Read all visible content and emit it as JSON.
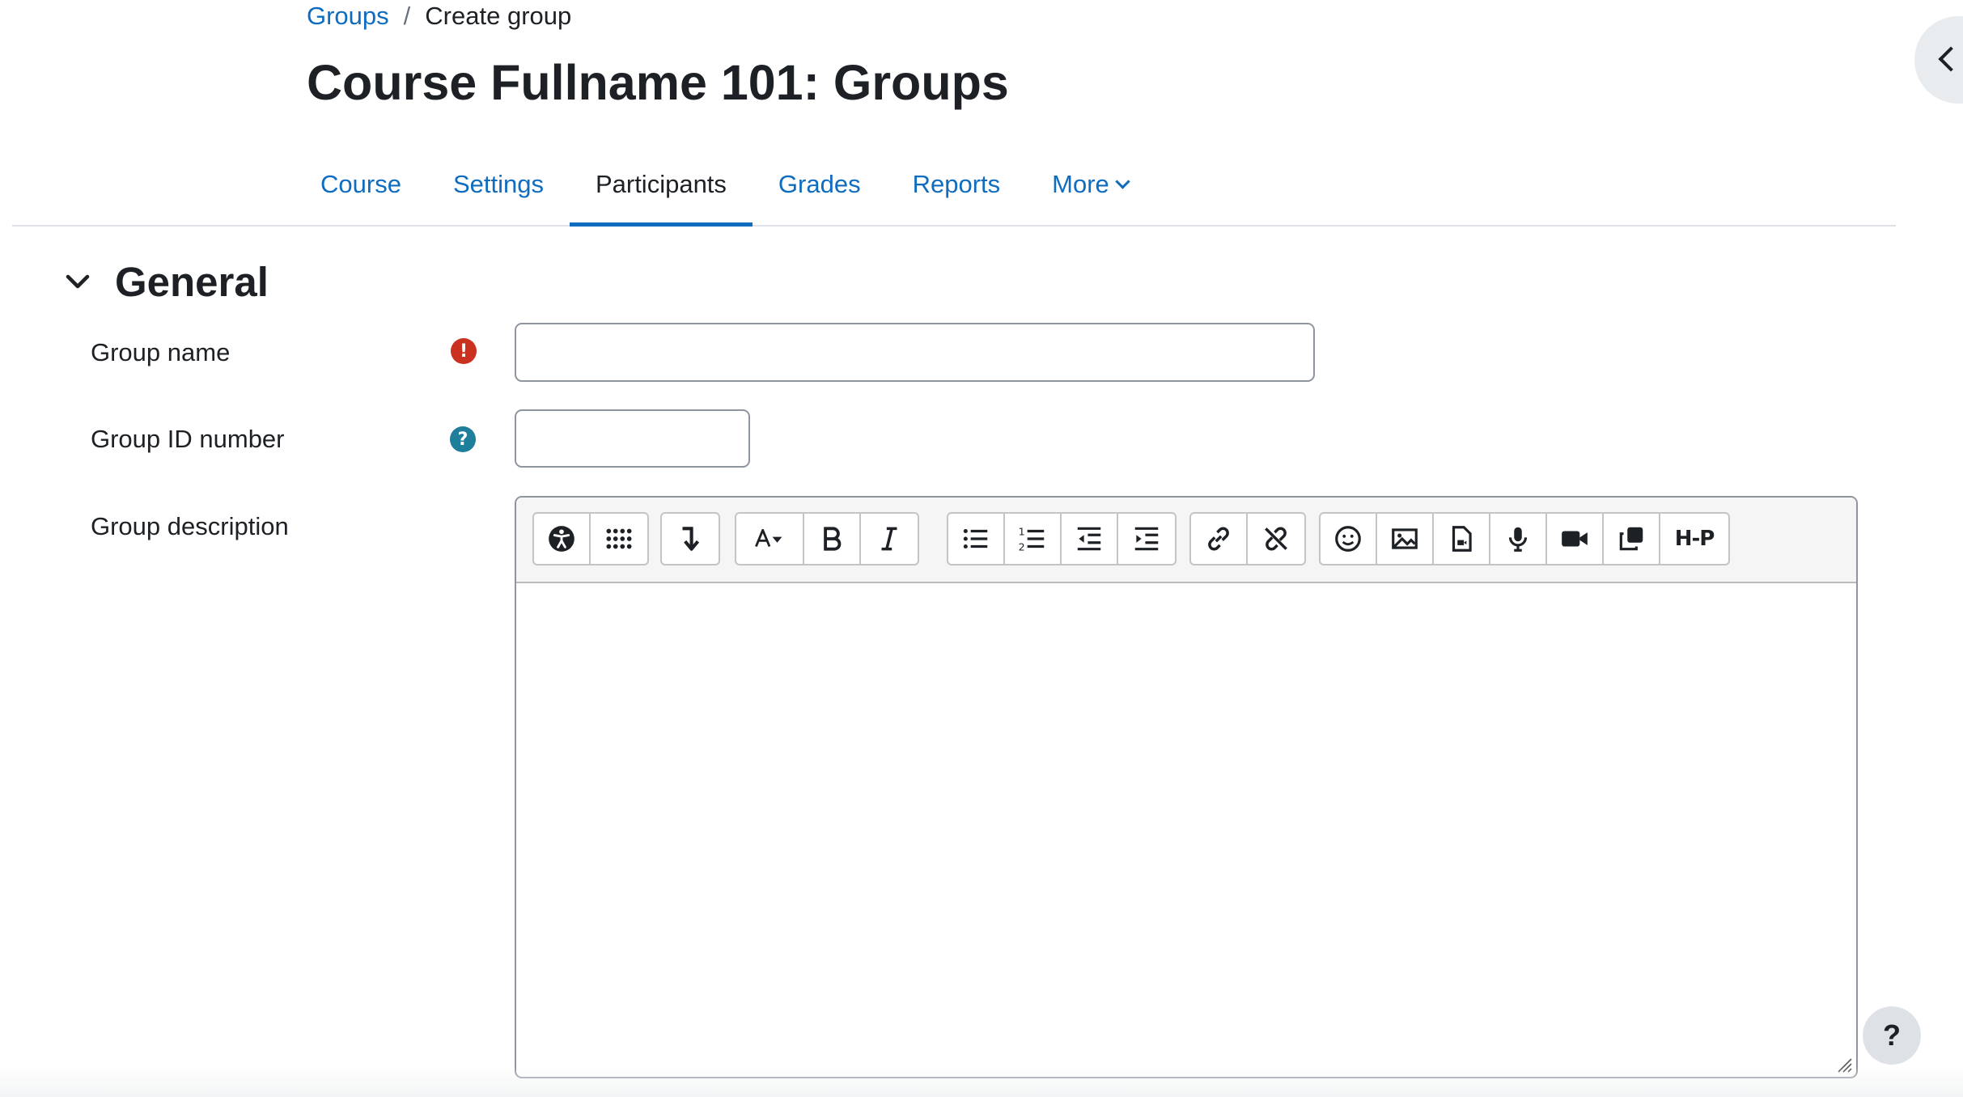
{
  "breadcrumb": {
    "parent": "Groups",
    "separator": "/",
    "current": "Create group"
  },
  "page_title": "Course Fullname 101: Groups",
  "nav": {
    "items": [
      {
        "label": "Course",
        "active": false
      },
      {
        "label": "Settings",
        "active": false
      },
      {
        "label": "Participants",
        "active": true
      },
      {
        "label": "Grades",
        "active": false
      },
      {
        "label": "Reports",
        "active": false
      },
      {
        "label": "More",
        "active": false
      }
    ]
  },
  "section": {
    "title": "General"
  },
  "form": {
    "group_name": {
      "label": "Group name",
      "value": "",
      "required_icon": "!"
    },
    "group_id": {
      "label": "Group ID number",
      "value": "",
      "help_icon": "?"
    },
    "group_description": {
      "label": "Group description"
    }
  },
  "editor": {
    "h5p_label": "H-P",
    "toolbar_icons": [
      "accessibility-checker",
      "show-more",
      "screenreader-helper",
      "font-style",
      "bold",
      "italic",
      "unordered-list",
      "ordered-list",
      "outdent",
      "indent",
      "link",
      "unlink",
      "emoji",
      "image",
      "media-file",
      "record-audio",
      "record-video",
      "manage-files",
      "h5p"
    ]
  },
  "help_button": "?",
  "colors": {
    "link": "#0f6cbf",
    "required": "#ca3120",
    "help": "#1f7e9a",
    "text": "#1d2125"
  }
}
